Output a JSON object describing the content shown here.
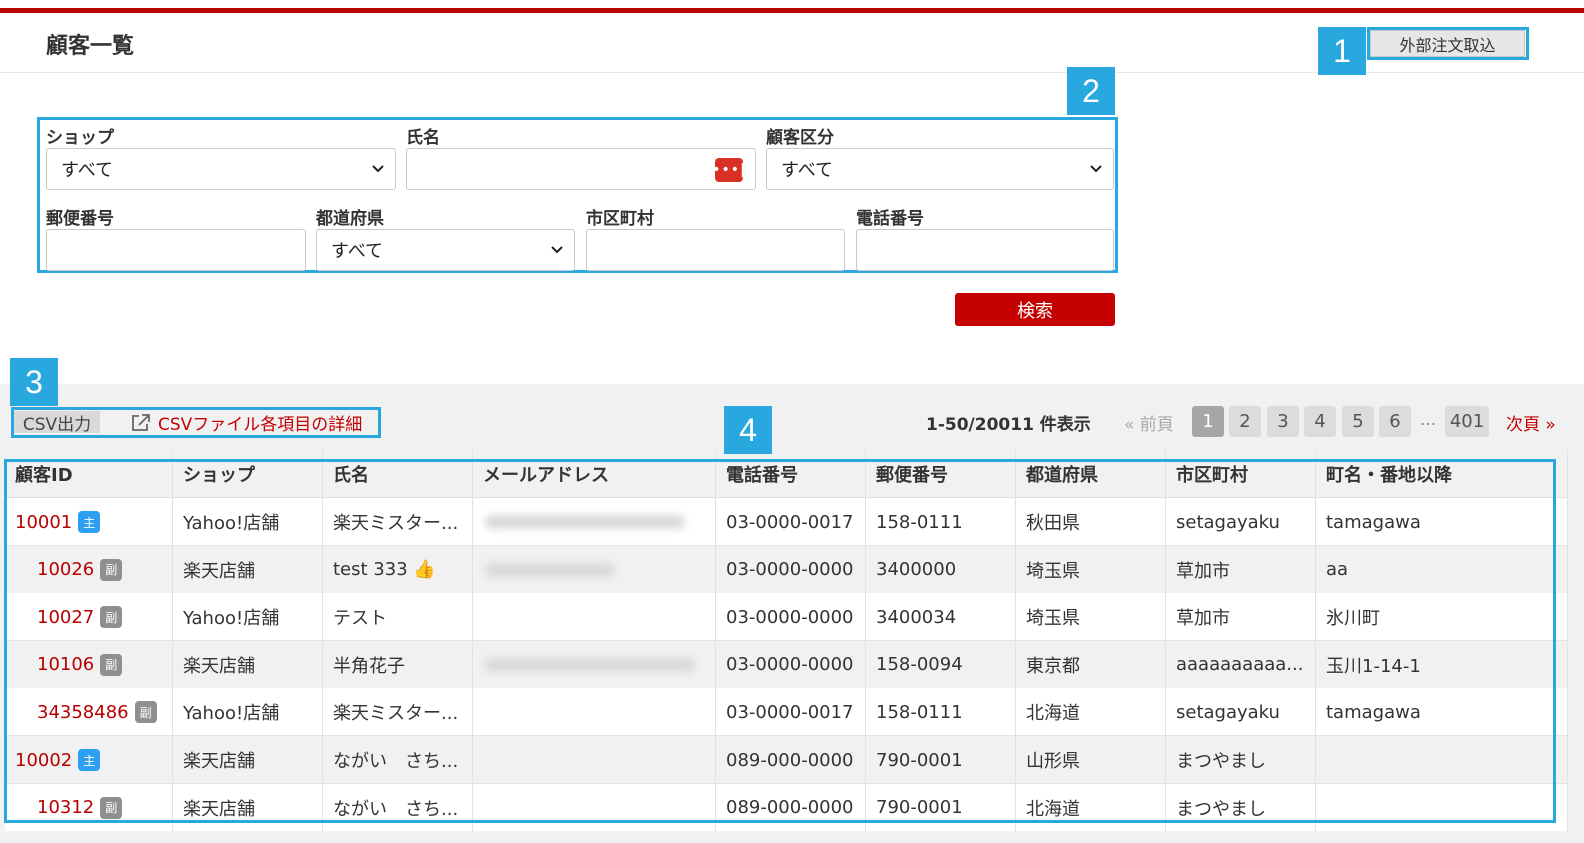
{
  "page": {
    "title": "顧客一覧",
    "import_button": "外部注文取込"
  },
  "callouts": [
    "1",
    "2",
    "3",
    "4"
  ],
  "filters": {
    "shop": {
      "label": "ショップ",
      "value": "すべて"
    },
    "name": {
      "label": "氏名",
      "value": ""
    },
    "customer_type": {
      "label": "顧客区分",
      "value": "すべて"
    },
    "postal": {
      "label": "郵便番号",
      "value": ""
    },
    "prefecture": {
      "label": "都道府県",
      "value": "すべて"
    },
    "city": {
      "label": "市区町村",
      "value": ""
    },
    "phone": {
      "label": "電話番号",
      "value": ""
    },
    "search_button": "検索"
  },
  "toolbar": {
    "csv_button": "CSV出力",
    "csv_detail_link": "CSVファイル各項目の詳細",
    "count": "1-50/20011 件表示"
  },
  "pagination": {
    "prev": "« 前頁",
    "pages": [
      "1",
      "2",
      "3",
      "4",
      "5",
      "6"
    ],
    "ellipsis": "...",
    "last": "401",
    "next": "次頁 »",
    "current": "1"
  },
  "badges": {
    "main": "主",
    "sub": "副"
  },
  "table": {
    "headers": [
      "顧客ID",
      "ショップ",
      "氏名",
      "メールアドレス",
      "電話番号",
      "郵便番号",
      "都道府県",
      "市区町村",
      "町名・番地以降"
    ],
    "rows": [
      {
        "id": "10001",
        "type": "main",
        "shop": "Yahoo!店舗",
        "name": "楽天ミスター...",
        "phone": "03-0000-0017",
        "postal": "158-0111",
        "pref": "秋田県",
        "city": "setagayaku",
        "town": "tamagawa"
      },
      {
        "id": "10026",
        "type": "sub",
        "shop": "楽天店舗",
        "name": "test 333 👍",
        "phone": "03-0000-0000",
        "postal": "3400000",
        "pref": "埼玉県",
        "city": "草加市",
        "town": "aa"
      },
      {
        "id": "10027",
        "type": "sub",
        "shop": "Yahoo!店舗",
        "name": "テスト",
        "phone": "03-0000-0000",
        "postal": "3400034",
        "pref": "埼玉県",
        "city": "草加市",
        "town": "氷川町"
      },
      {
        "id": "10106",
        "type": "sub",
        "shop": "楽天店舗",
        "name": "半角花子",
        "phone": "03-0000-0000",
        "postal": "158-0094",
        "pref": "東京都",
        "city": "aaaaaaaaaa...",
        "town": "玉川1-14-1"
      },
      {
        "id": "34358486",
        "type": "sub",
        "shop": "Yahoo!店舗",
        "name": "楽天ミスター...",
        "phone": "03-0000-0017",
        "postal": "158-0111",
        "pref": "北海道",
        "city": "setagayaku",
        "town": "tamagawa"
      },
      {
        "id": "10002",
        "type": "main",
        "shop": "楽天店舗",
        "name": "ながい　さち...",
        "phone": "089-000-0000",
        "postal": "790-0001",
        "pref": "山形県",
        "city": "まつやまし",
        "town": ""
      },
      {
        "id": "10312",
        "type": "sub",
        "shop": "楽天店舗",
        "name": "ながい　さち...",
        "phone": "089-000-0000",
        "postal": "790-0001",
        "pref": "北海道",
        "city": "まつやまし",
        "town": ""
      }
    ]
  },
  "colors": {
    "accent_red": "#c40000",
    "callout_blue": "#29a8e0",
    "badge_main": "#2d9ef0",
    "badge_sub": "#8f8f8f"
  }
}
